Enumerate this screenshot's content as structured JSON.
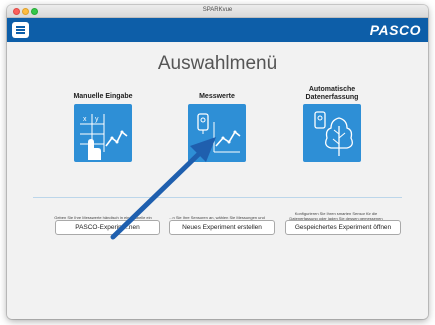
{
  "window": {
    "title": "SPARKvue"
  },
  "appbar": {
    "brand": "PASCO",
    "menu_icon": "hamburger-menu-icon"
  },
  "main": {
    "title": "Auswahlmenü",
    "options": [
      {
        "label": "Manuelle Eingabe",
        "icon": "manual-entry-icon",
        "description": "Geben Sie Ihre Messwerte händisch in eine Tabelle ein und sehen Sie sie im Graphen..."
      },
      {
        "label": "Messwerte",
        "icon": "sensor-graph-icon",
        "description": "...n Sie Ihre Sensoren an, wählen Sie Messungen und Anzeigen..."
      },
      {
        "label": "Automatische Datenerfassung",
        "icon": "auto-capture-tree-icon",
        "description": "Konfigurieren Sie Ihren smarten Sensor für die Datenerfassung oder laden Sie dessen gemessenen Werte herunter..."
      }
    ],
    "buttons": [
      {
        "label": "PASCO-Experim...nen"
      },
      {
        "label": "Neues Experiment erstellen"
      },
      {
        "label": "Gespeichertes Experiment öffnen"
      }
    ]
  },
  "colors": {
    "appbar": "#0d5ea8",
    "tile": "#2e8fd6",
    "annotation_arrow": "#1f5fae"
  }
}
